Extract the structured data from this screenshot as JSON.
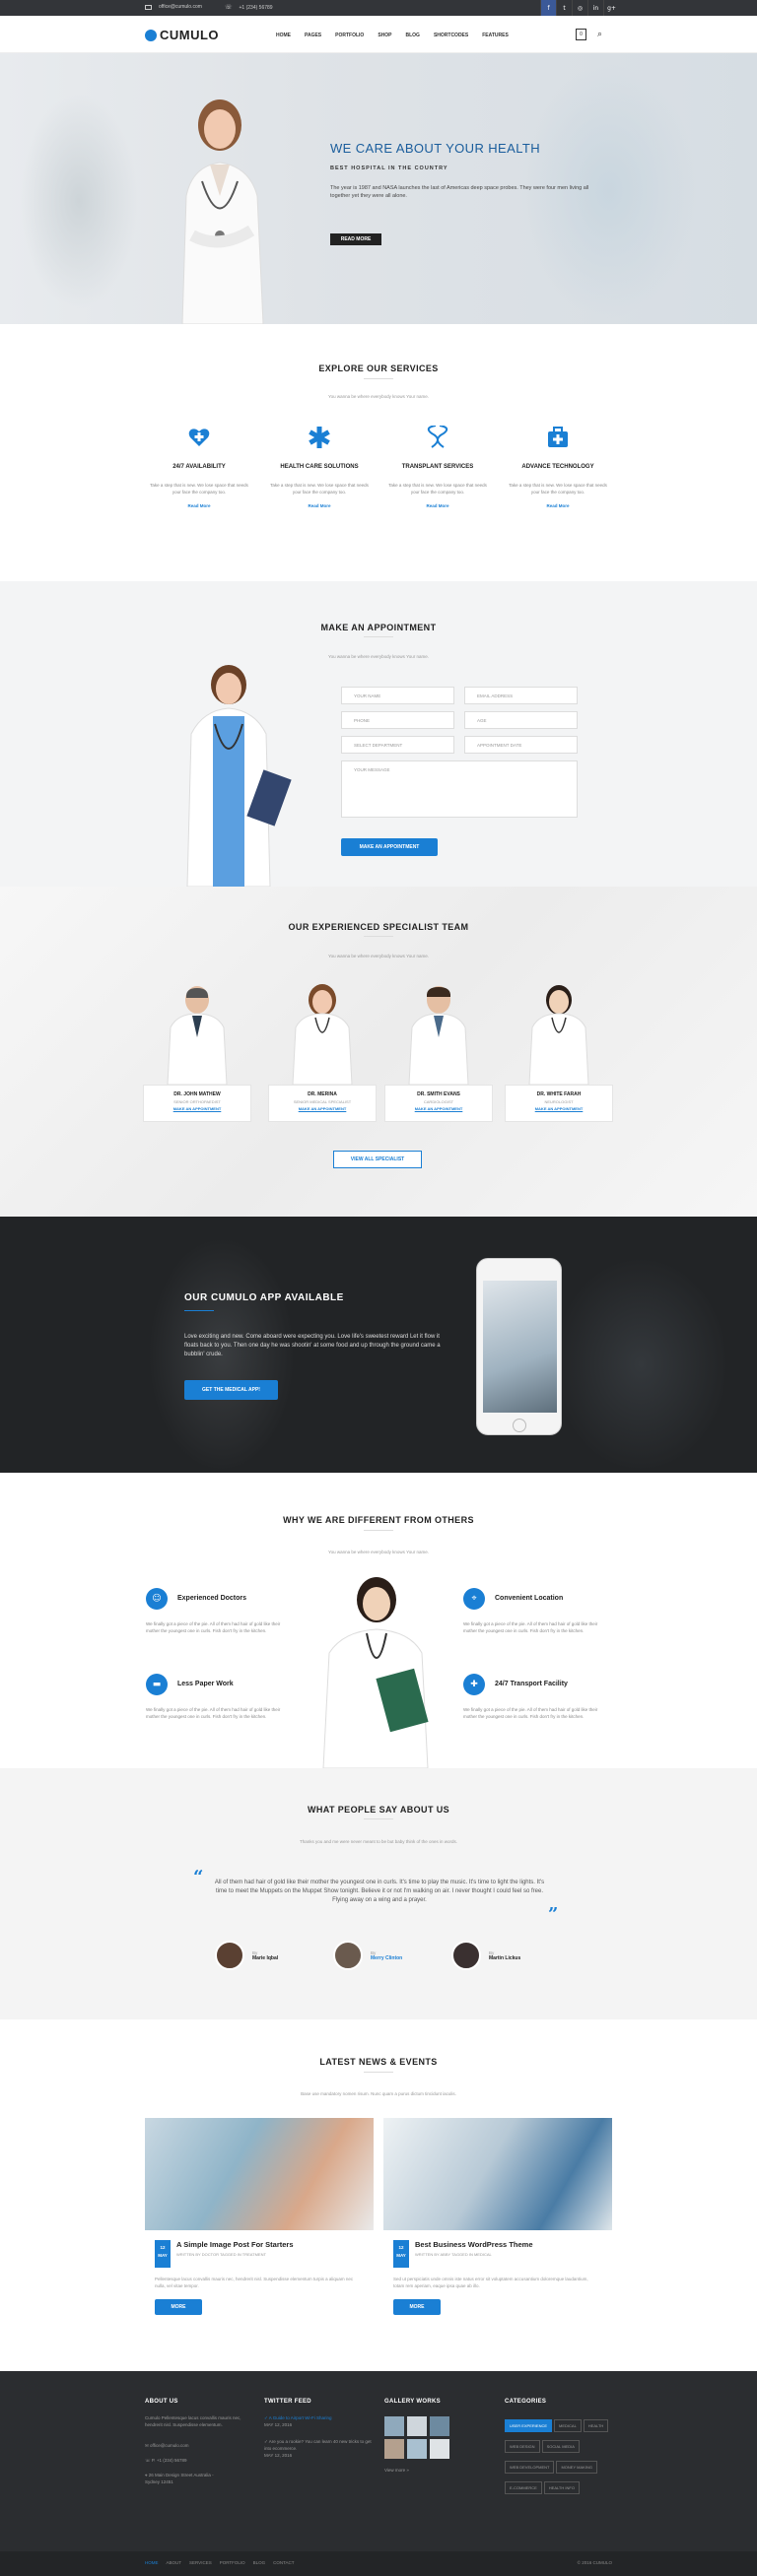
{
  "topbar": {
    "email": "office@cumulo.com",
    "phone": "+1 (234) 56789"
  },
  "social_icons": [
    "facebook-icon",
    "twitter-icon",
    "dribbble-icon",
    "linkedin-icon",
    "googleplus-icon"
  ],
  "logo": "CUMULO",
  "nav": [
    "HOME",
    "PAGES",
    "PORTFOLIO",
    "SHOP",
    "BLOG",
    "SHORTCODES",
    "FEATURES"
  ],
  "cart_count": "0",
  "hero": {
    "title": "WE CARE ABOUT YOUR HEALTH",
    "subtitle": "BEST HOSPITAL IN THE COUNTRY",
    "body": "The year is 1987 and NASA launches the last of Americas deep space probes. They were four men living all together yet they were all alone.",
    "button": "READ MORE"
  },
  "services": {
    "title": "EXPLORE OUR SERVICES",
    "subtitle": "You wanna be where everybody knows Your name.",
    "items": [
      {
        "icon": "heart-plus-icon",
        "title": "24/7 AVAILABILITY",
        "desc": "Take a step that is new. We lose space that needs your face the company too.",
        "link": "Read More"
      },
      {
        "icon": "medical-star-icon",
        "title": "HEALTH CARE SOLUTIONS",
        "desc": "Take a step that is new. We lose space that needs your face the company too.",
        "link": "Read More"
      },
      {
        "icon": "dna-icon",
        "title": "TRANSPLANT SERVICES",
        "desc": "Take a step that is new. We lose space that needs your face the company too.",
        "link": "Read More"
      },
      {
        "icon": "medkit-icon",
        "title": "ADVANCE TECHNOLOGY",
        "desc": "Take a step that is new. We lose space that needs your face the company too.",
        "link": "Read More"
      }
    ]
  },
  "appointment": {
    "title": "MAKE AN APPOINTMENT",
    "subtitle": "You wanna be where everybody knows Your name.",
    "fields": {
      "name": "YOUR NAME",
      "email": "EMAIL ADDRESS",
      "phone": "PHONE",
      "age": "AGE",
      "dept": "SELECT DEPARTMENT",
      "date": "APPOINTMENT DATE",
      "message": "YOUR MESSAGE"
    },
    "button": "MAKE AN APPOINTMENT"
  },
  "team": {
    "title": "OUR EXPERIENCED SPECIALIST TEAM",
    "subtitle": "You wanna be where everybody knows Your name.",
    "doctors": [
      {
        "name": "DR. JOHN MATHEW",
        "spec": "SENIOR ORTHOPAEDIST",
        "link": "MAKE AN APPOINTMENT"
      },
      {
        "name": "DR. MERINA",
        "spec": "SENIOR MEDICAL SPECIALIST",
        "link": "MAKE AN APPOINTMENT"
      },
      {
        "name": "DR. SMITH EVANS",
        "spec": "CARDIOLOGIST",
        "link": "MAKE AN APPOINTMENT"
      },
      {
        "name": "DR. WHITE FARAH",
        "spec": "NEUROLOGIST",
        "link": "MAKE AN APPOINTMENT"
      }
    ],
    "button": "VIEW ALL SPECIALIST"
  },
  "app": {
    "title": "OUR CUMULO APP AVAILABLE",
    "body": "Love exciting and new. Come aboard were expecting you. Love life's sweetest reward Let it flow it floats back to you. Then one day he was shootin' at some food and up through the ground came a bubblin' crude.",
    "button": "GET THE MEDICAL APP!"
  },
  "different": {
    "title": "WHY WE ARE DIFFERENT FROM OTHERS",
    "subtitle": "You wanna be where everybody knows Your name.",
    "items": [
      {
        "icon": "user-doctor-icon",
        "title": "Experienced Doctors",
        "desc": "We finally got a piece of the pie. All of them had hair of gold like their mother the youngest one in curls. Fish don't fry in the kitchen."
      },
      {
        "icon": "location-icon",
        "title": "Convenient Location",
        "desc": "We finally got a piece of the pie. All of them had hair of gold like their mother the youngest one in curls. Fish don't fry in the kitchen."
      },
      {
        "icon": "folder-icon",
        "title": "Less Paper Work",
        "desc": "We finally got a piece of the pie. All of them had hair of gold like their mother the youngest one in curls. Fish don't fry in the kitchen."
      },
      {
        "icon": "ambulance-icon",
        "title": "24/7 Transport Facility",
        "desc": "We finally got a piece of the pie. All of them had hair of gold like their mother the youngest one in curls. Fish don't fry in the kitchen."
      }
    ]
  },
  "testimonials": {
    "title": "WHAT PEOPLE SAY ABOUT US",
    "subtitle": "Thanks you and me were never meant to be but baby think of the ones in words.",
    "quote": "All of them had hair of gold like their mother the youngest one in curls. It's time to play the music. It's time to light the lights. It's time to meet the Muppets on the Muppet Show tonight. Believe it or not I'm walking on air. I never thought I could feel so free. Flying away on a wing and a prayer.",
    "people": [
      {
        "by": "By",
        "name": "Marie Iqbal"
      },
      {
        "by": "By",
        "name": "Merry Clinton"
      },
      {
        "by": "By",
        "name": "Martin Lickus"
      }
    ]
  },
  "news": {
    "title": "LATEST NEWS & EVENTS",
    "subtitle": "Base use mandatory nomen risum. Nunc quam a purus dictum tincidunt iaculis.",
    "posts": [
      {
        "day": "12",
        "mon": "MAY",
        "title": "A Simple Image Post For Starters",
        "meta": "WRITTEN BY DOCTOR   TAGGED IN TREATMENT",
        "excerpt": "Pellentesque lacus convallis mauris nec, hendrerit nisl. Suspendisse elementum turpis a aliquam nec nulla, vel vitae tempor.",
        "button": "MORE"
      },
      {
        "day": "12",
        "mon": "MAY",
        "title": "Best Business WordPress Theme",
        "meta": "WRITTEN BY ABBY   TAGGED IN MEDICAL",
        "excerpt": "Sed ut perspiciatis unde omnis iste natus error sit voluptatem accusantium doloremque laudantium, totam rem aperiam, eaque ipsa quae ab illo.",
        "button": "MORE"
      }
    ]
  },
  "footer": {
    "about": {
      "title": "ABOUT US",
      "text": "Cumulo Pellentesque lacus convallis mauris nec, hendrerit nisl. Suspendisse elementum.",
      "email": "office@cumulo.com",
      "phone": "P. +1 (234) 56789",
      "addr": "26 Main Design Street Australia - Sydney 12451"
    },
    "twitter": {
      "title": "TWITTER FEED",
      "t1": "A Guide to Airport Wi-Fi Sharing",
      "t1d": "MAY 12, 2016",
      "t2": "Are you a rookie? You can learn 40 new tricks to get into ecommerce.",
      "t2d": "MAY 12, 2016"
    },
    "gallery": {
      "title": "GALLERY WORKS",
      "more": "View more »"
    },
    "categories": {
      "title": "CATEGORIES",
      "tags": [
        "USER EXPERIENCE",
        "MEDICAL",
        "HEALTH",
        "WEB DESIGN",
        "SOCIAL MEDIA",
        "WEB DEVELOPMENT",
        "MONEY MAKING",
        "E-COMMERCE",
        "HEALTH INFO"
      ]
    },
    "links": [
      "HOME",
      "ABOUT",
      "SERVICES",
      "PORTFOLIO",
      "BLOG",
      "CONTACT"
    ],
    "copyright": "© 2016 CUMULO"
  }
}
